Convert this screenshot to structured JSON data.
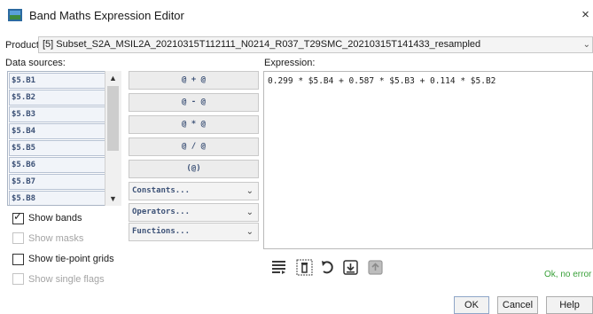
{
  "window": {
    "title": "Band Maths Expression Editor",
    "close_glyph": "×"
  },
  "product": {
    "label": "Product:",
    "value": "[5] Subset_S2A_MSIL2A_20210315T112111_N0214_R037_T29SMC_20210315T141433_resampled"
  },
  "data_sources": {
    "label": "Data sources:",
    "bands": [
      "$5.B1",
      "$5.B2",
      "$5.B3",
      "$5.B4",
      "$5.B5",
      "$5.B6",
      "$5.B7",
      "$5.B8"
    ]
  },
  "options": {
    "show_bands": {
      "label": "Show bands",
      "checked": true,
      "enabled": true
    },
    "show_masks": {
      "label": "Show masks",
      "checked": false,
      "enabled": false
    },
    "show_tie_point_grids": {
      "label": "Show tie-point grids",
      "checked": false,
      "enabled": true
    },
    "show_single_flags": {
      "label": "Show single flags",
      "checked": false,
      "enabled": false
    }
  },
  "operators": {
    "add": "@ + @",
    "subtract": "@ - @",
    "multiply": "@ * @",
    "divide": "@ / @",
    "parens": "(@)",
    "constants": "Constants...",
    "operators": "Operators...",
    "functions": "Functions..."
  },
  "expression": {
    "label": "Expression:",
    "text": "0.299 * $5.B4 + 0.587 * $5.B3 + 0.114 * $5.B2"
  },
  "status": "Ok, no error",
  "buttons": {
    "ok": "OK",
    "cancel": "Cancel",
    "help": "Help"
  },
  "colors": {
    "band_text": "#3d5277",
    "status_ok": "#3aa13a"
  }
}
